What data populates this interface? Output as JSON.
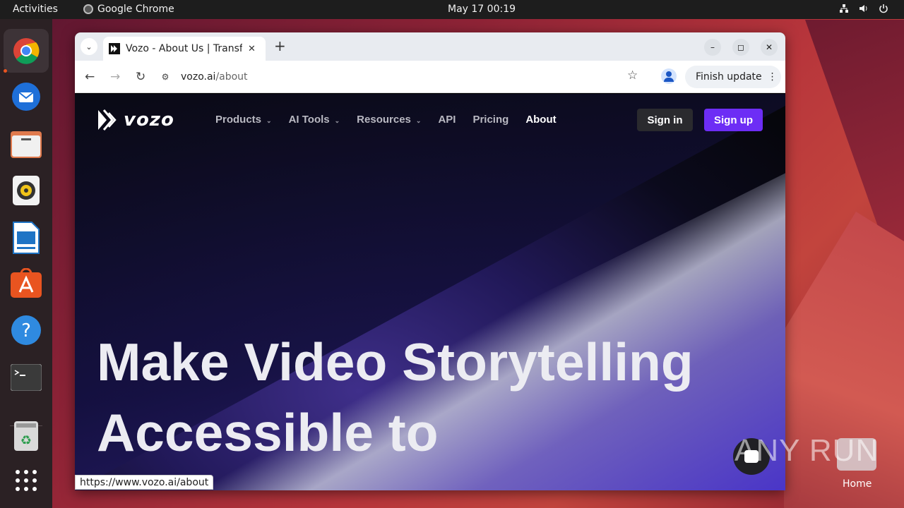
{
  "topbar": {
    "activities": "Activities",
    "app_name": "Google Chrome",
    "clock": "May 17  00:19",
    "tray_icons": [
      "network-icon",
      "volume-icon",
      "power-icon"
    ]
  },
  "dock": {
    "items": [
      "chrome-icon",
      "thunderbird-icon",
      "files-icon",
      "rhythmbox-icon",
      "writer-icon",
      "app-center-icon",
      "help-icon",
      "terminal-icon",
      "trash-icon",
      "app-grid-icon"
    ]
  },
  "browser": {
    "tab_title": "Vozo - About Us | Transfo",
    "new_tab": "+",
    "url_host": "vozo.ai",
    "url_path": "/about",
    "finish_update": "Finish update",
    "status_url": "https://www.vozo.ai/about"
  },
  "site": {
    "logo": "vozo",
    "menu": [
      {
        "label": "Products",
        "dropdown": true
      },
      {
        "label": "AI Tools",
        "dropdown": true
      },
      {
        "label": "Resources",
        "dropdown": true
      },
      {
        "label": "API",
        "dropdown": false
      },
      {
        "label": "Pricing",
        "dropdown": false
      },
      {
        "label": "About",
        "dropdown": false
      }
    ],
    "signin": "Sign in",
    "signup": "Sign up",
    "hero_line1": "Make Video Storytelling",
    "hero_line2": "Accessible to",
    "accent_color": "#6d2df5"
  },
  "desktop": {
    "home_label": "Home",
    "watermark": "ANY RUN"
  }
}
